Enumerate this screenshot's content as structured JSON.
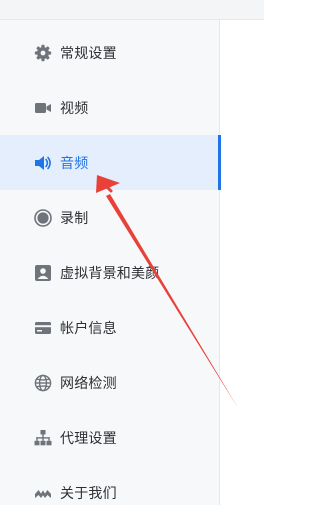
{
  "sidebar": {
    "items": [
      {
        "label": "常规设置",
        "icon": "gear-icon",
        "active": false
      },
      {
        "label": "视频",
        "icon": "video-camera-icon",
        "active": false
      },
      {
        "label": "音频",
        "icon": "speaker-icon",
        "active": true
      },
      {
        "label": "录制",
        "icon": "record-icon",
        "active": false
      },
      {
        "label": "虚拟背景和美颜",
        "icon": "portrait-icon",
        "active": false
      },
      {
        "label": "帐户信息",
        "icon": "card-icon",
        "active": false
      },
      {
        "label": "网络检测",
        "icon": "globe-icon",
        "active": false
      },
      {
        "label": "代理设置",
        "icon": "network-tree-icon",
        "active": false
      },
      {
        "label": "关于我们",
        "icon": "crown-icon",
        "active": false
      }
    ]
  },
  "colors": {
    "accent": "#1f74e8",
    "active_background": "#e4eefc",
    "sidebar_background": "#f7f8fa",
    "icon_gray": "#6f747b",
    "annotation_arrow": "#e8413a"
  },
  "annotation": {
    "type": "red-arrow",
    "points_to": "sidebar.items.2"
  }
}
